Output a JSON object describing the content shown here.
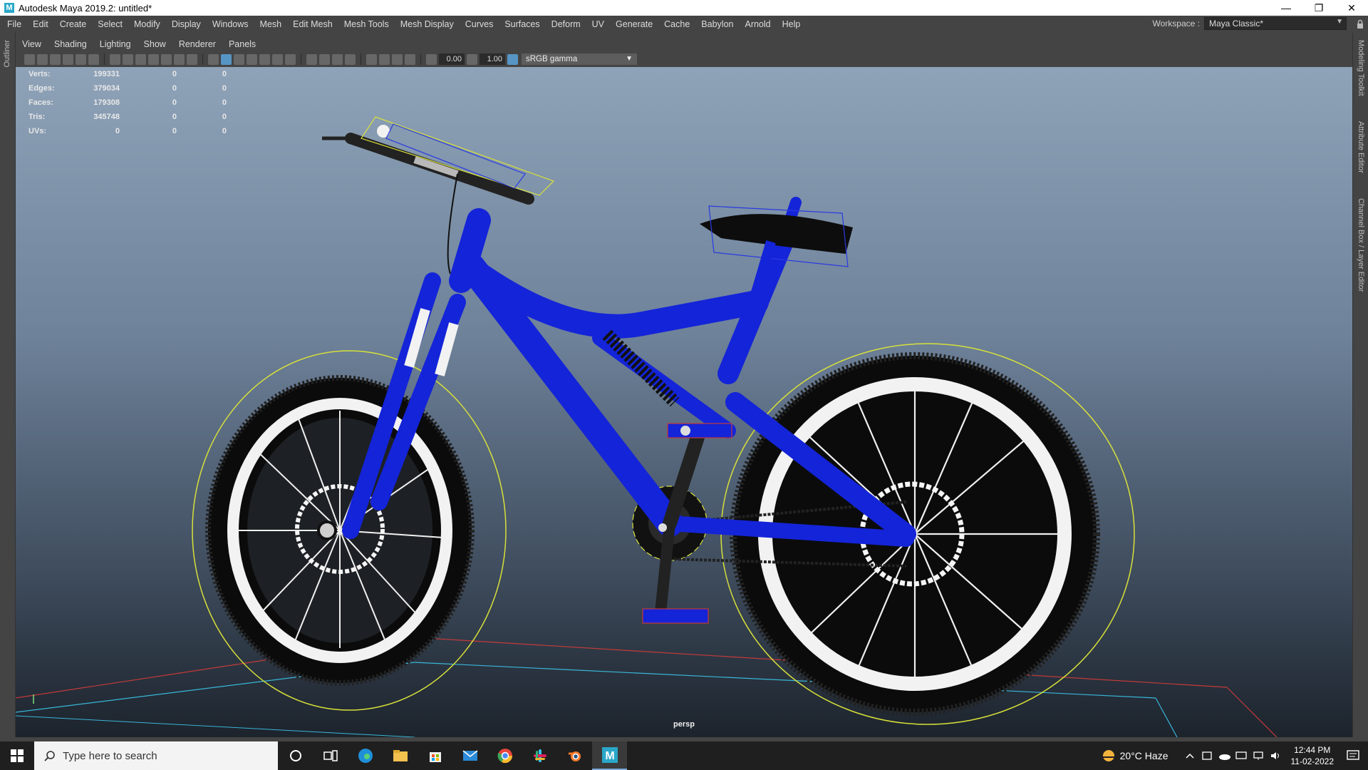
{
  "window": {
    "title": "Autodesk Maya 2019.2: untitled*",
    "controls": [
      "minimize-icon",
      "restore-icon",
      "close-icon"
    ]
  },
  "menubar": {
    "items": [
      "File",
      "Edit",
      "Create",
      "Select",
      "Modify",
      "Display",
      "Windows",
      "Mesh",
      "Edit Mesh",
      "Mesh Tools",
      "Mesh Display",
      "Curves",
      "Surfaces",
      "Deform",
      "UV",
      "Generate",
      "Cache",
      "Babylon",
      "Arnold",
      "Help"
    ],
    "workspace_label": "Workspace :",
    "workspace_value": "Maya Classic*"
  },
  "side_tabs": {
    "left": "Outliner",
    "right": [
      "Modeling Toolkit",
      "Attribute Editor",
      "Channel Box / Layer Editor"
    ]
  },
  "panel_menu": [
    "View",
    "Shading",
    "Lighting",
    "Show",
    "Renderer",
    "Panels"
  ],
  "viewport_toolbar": {
    "exposure": "0.00",
    "gamma": "1.00",
    "color_space": "sRGB gamma"
  },
  "hud": {
    "rows": [
      {
        "label": "Verts:",
        "v1": "199331",
        "v2": "0",
        "v3": "0"
      },
      {
        "label": "Edges:",
        "v1": "379034",
        "v2": "0",
        "v3": "0"
      },
      {
        "label": "Faces:",
        "v1": "179308",
        "v2": "0",
        "v3": "0"
      },
      {
        "label": "Tris:",
        "v1": "345748",
        "v2": "0",
        "v3": "0"
      },
      {
        "label": "UVs:",
        "v1": "0",
        "v2": "0",
        "v3": "0"
      }
    ]
  },
  "camera": "persp",
  "colors": {
    "bike_frame": "#1424d8",
    "selection_outline": "#d8e03a",
    "grid_x_axis": "#c43a3a",
    "grid_z_axis": "#3ab6d8"
  },
  "taskbar": {
    "search_placeholder": "Type here to search",
    "apps": [
      "cortana-icon",
      "task-view-icon",
      "edge-icon",
      "file-explorer-icon",
      "store-icon",
      "mail-icon",
      "chrome-icon",
      "slack-icon",
      "blender-icon",
      "maya-icon"
    ],
    "weather": "20°C  Haze",
    "time": "12:44 PM",
    "date": "11-02-2022"
  }
}
